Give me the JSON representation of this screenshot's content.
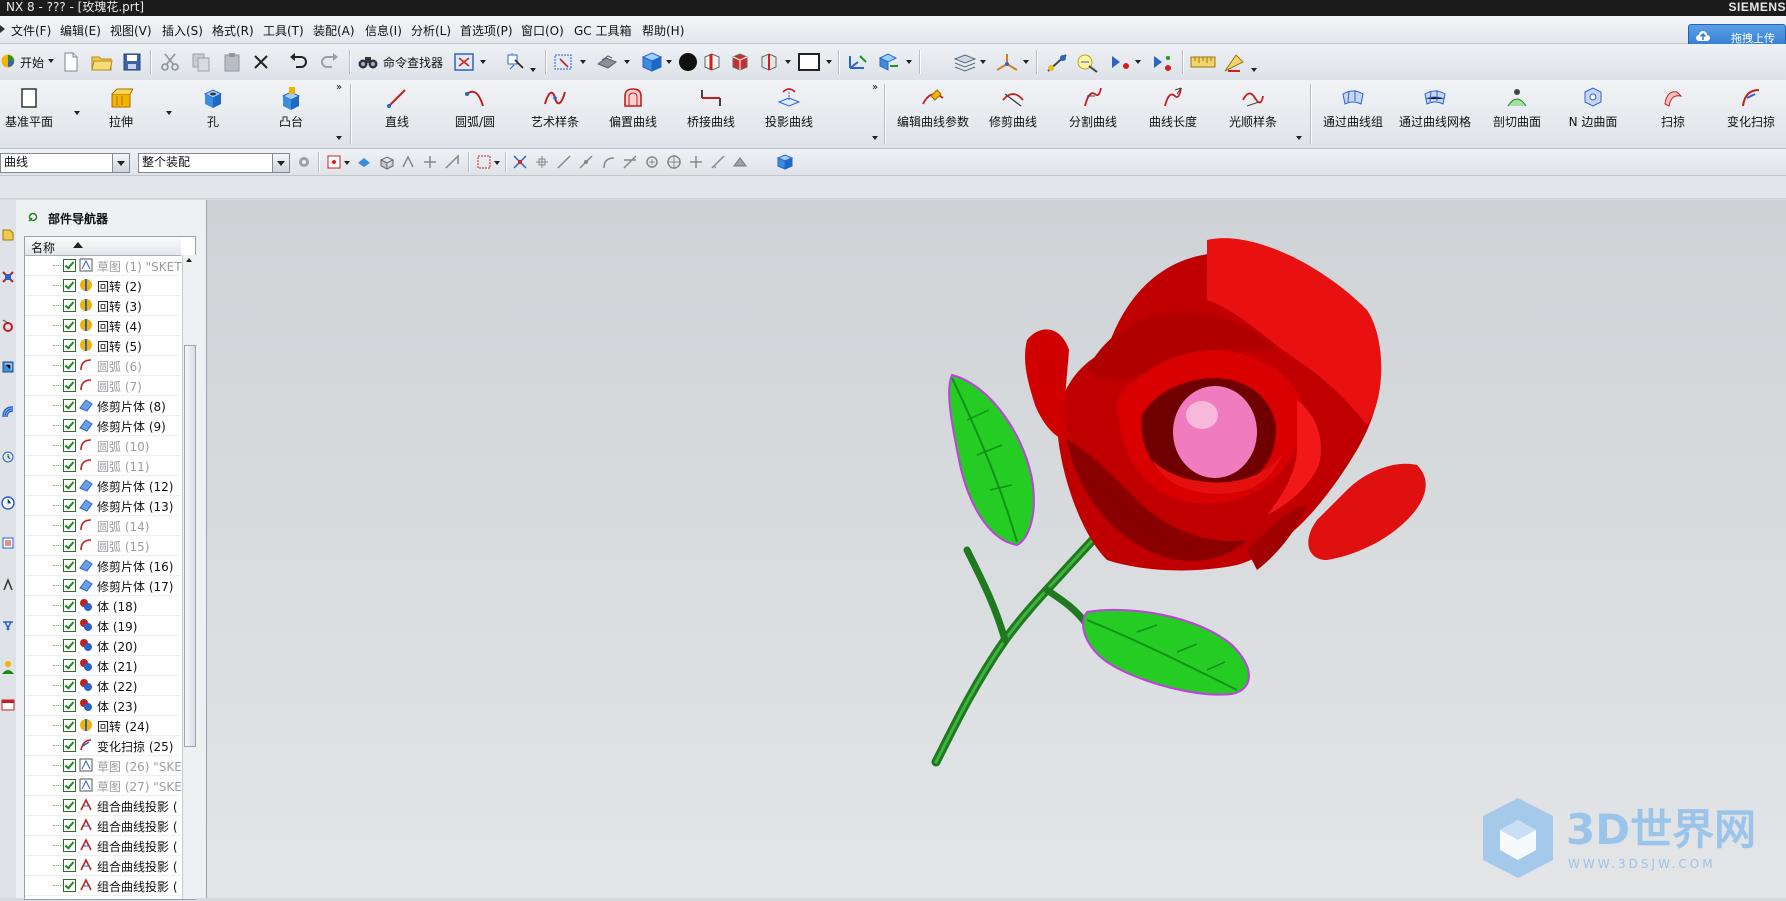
{
  "window": {
    "title": "NX 8 - ??? - [玫瑰花.prt]",
    "brand": "SIEMENS"
  },
  "menu": [
    "文件(F)",
    "编辑(E)",
    "视图(V)",
    "插入(S)",
    "格式(R)",
    "工具(T)",
    "装配(A)",
    "信息(I)",
    "分析(L)",
    "首选项(P)",
    "窗口(O)",
    "GC 工具箱",
    "帮助(H)"
  ],
  "upload_button": "拖拽上传",
  "toolbar1": {
    "start_label": "开始",
    "command_finder_label": "命令查找器"
  },
  "toolbar2": {
    "items": [
      "基准平面",
      "拉伸",
      "孔",
      "凸台",
      "直线",
      "圆弧/圆",
      "艺术样条",
      "偏置曲线",
      "桥接曲线",
      "投影曲线",
      "编辑曲线参数",
      "修剪曲线",
      "分割曲线",
      "曲线长度",
      "光顺样条",
      "通过曲线组",
      "通过曲线网格",
      "剖切曲面",
      "N 边曲面",
      "扫掠",
      "变化扫掠"
    ]
  },
  "selection_bar": {
    "filter_value": "曲线",
    "scope_value": "整个装配"
  },
  "part_navigator": {
    "title": "部件导航器",
    "column_name": "名称",
    "rows": [
      {
        "label": "草图 (1) \"SKET",
        "icon": "sketch-icon",
        "dim": true
      },
      {
        "label": "回转 (2)",
        "icon": "revolve-icon",
        "dim": false
      },
      {
        "label": "回转 (3)",
        "icon": "revolve-icon",
        "dim": false
      },
      {
        "label": "回转 (4)",
        "icon": "revolve-icon",
        "dim": false
      },
      {
        "label": "回转 (5)",
        "icon": "revolve-icon",
        "dim": false
      },
      {
        "label": "圆弧 (6)",
        "icon": "arc-icon",
        "dim": true
      },
      {
        "label": "圆弧 (7)",
        "icon": "arc-icon",
        "dim": true
      },
      {
        "label": "修剪片体 (8)",
        "icon": "trim-sheet-icon",
        "dim": false
      },
      {
        "label": "修剪片体 (9)",
        "icon": "trim-sheet-icon",
        "dim": false
      },
      {
        "label": "圆弧 (10)",
        "icon": "arc-icon",
        "dim": true
      },
      {
        "label": "圆弧 (11)",
        "icon": "arc-icon",
        "dim": true
      },
      {
        "label": "修剪片体 (12)",
        "icon": "trim-sheet-icon",
        "dim": false
      },
      {
        "label": "修剪片体 (13)",
        "icon": "trim-sheet-icon",
        "dim": false
      },
      {
        "label": "圆弧 (14)",
        "icon": "arc-icon",
        "dim": true
      },
      {
        "label": "圆弧 (15)",
        "icon": "arc-icon",
        "dim": true
      },
      {
        "label": "修剪片体 (16)",
        "icon": "trim-sheet-icon",
        "dim": false
      },
      {
        "label": "修剪片体 (17)",
        "icon": "trim-sheet-icon",
        "dim": false
      },
      {
        "label": "体 (18)",
        "icon": "body-icon",
        "dim": false
      },
      {
        "label": "体 (19)",
        "icon": "body-icon",
        "dim": false
      },
      {
        "label": "体 (20)",
        "icon": "body-icon",
        "dim": false
      },
      {
        "label": "体 (21)",
        "icon": "body-icon",
        "dim": false
      },
      {
        "label": "体 (22)",
        "icon": "body-icon",
        "dim": false
      },
      {
        "label": "体 (23)",
        "icon": "body-icon",
        "dim": false
      },
      {
        "label": "回转 (24)",
        "icon": "revolve-icon",
        "dim": false
      },
      {
        "label": "变化扫掠 (25)",
        "icon": "variational-sweep-icon",
        "dim": false
      },
      {
        "label": "草图 (26) \"SKE",
        "icon": "sketch-icon",
        "dim": true
      },
      {
        "label": "草图 (27) \"SKE",
        "icon": "sketch-icon",
        "dim": true
      },
      {
        "label": "组合曲线投影 (",
        "icon": "combined-projection-icon",
        "dim": false
      },
      {
        "label": "组合曲线投影 (",
        "icon": "combined-projection-icon",
        "dim": false
      },
      {
        "label": "组合曲线投影 (",
        "icon": "combined-projection-icon",
        "dim": false
      },
      {
        "label": "组合曲线投影 (",
        "icon": "combined-projection-icon",
        "dim": false
      },
      {
        "label": "组合曲线投影 (",
        "icon": "combined-projection-icon",
        "dim": false
      }
    ]
  },
  "watermark": {
    "logo_text": "3D世界网",
    "url": "WWW.3DSJW.COM"
  },
  "colors": {
    "petal": "#e00000",
    "leaf": "#22cc22",
    "stem": "#1f7a1f",
    "center": "#f07bbf",
    "highlight": "#c040e0"
  }
}
